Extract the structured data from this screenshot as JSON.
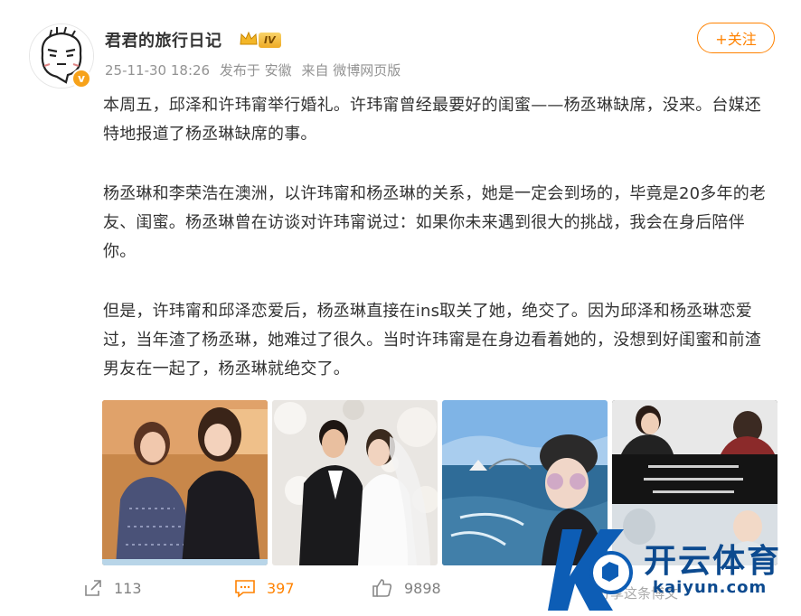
{
  "user": {
    "name": "君君的旅行日记",
    "level": "IV",
    "verified_mark": "v"
  },
  "meta": {
    "time": "25-11-30 18:26",
    "location": "发布于 安徽",
    "source": "来自 微博网页版"
  },
  "follow_label": "+关注",
  "post": {
    "paragraphs": [
      "本周五，邱泽和许玮甯举行婚礼。许玮甯曾经最要好的闺蜜——杨丞琳缺席，没来。台媒还特地报道了杨丞琳缺席的事。",
      "杨丞琳和李荣浩在澳洲，以许玮甯和杨丞琳的关系，她是一定会到场的，毕竟是20多年的老友、闺蜜。杨丞琳曾在访谈对许玮甯说过：如果你未来遇到很大的挑战，我会在身后陪伴你。",
      "但是，许玮甯和邱泽恋爱后，杨丞琳直接在ins取关了她，绝交了。因为邱泽和杨丞琳恋爱过，当年渣了杨丞琳，她难过了很久。当时许玮甯是在身边看着她的，没想到好闺蜜和前渣男友在一起了，杨丞琳就绝交了。"
    ]
  },
  "images": [
    {
      "name": "photo-two-women"
    },
    {
      "name": "photo-wedding"
    },
    {
      "name": "photo-harbour-selfie"
    },
    {
      "name": "photo-interview-collage"
    }
  ],
  "footer": {
    "share_count": "113",
    "comment_count": "397",
    "like_count": "9898"
  },
  "watermark": {
    "title": "开云体育",
    "url": "kaiyun.com",
    "ghost_text": "分享这条博文"
  },
  "colors": {
    "accent": "#ff8200",
    "text": "#333333",
    "meta": "#939393",
    "watermark": "#0c4a8f"
  },
  "icons": {
    "share": "share-icon",
    "comment": "comment-icon",
    "like": "thumbs-up-icon",
    "crown": "crown-icon"
  }
}
